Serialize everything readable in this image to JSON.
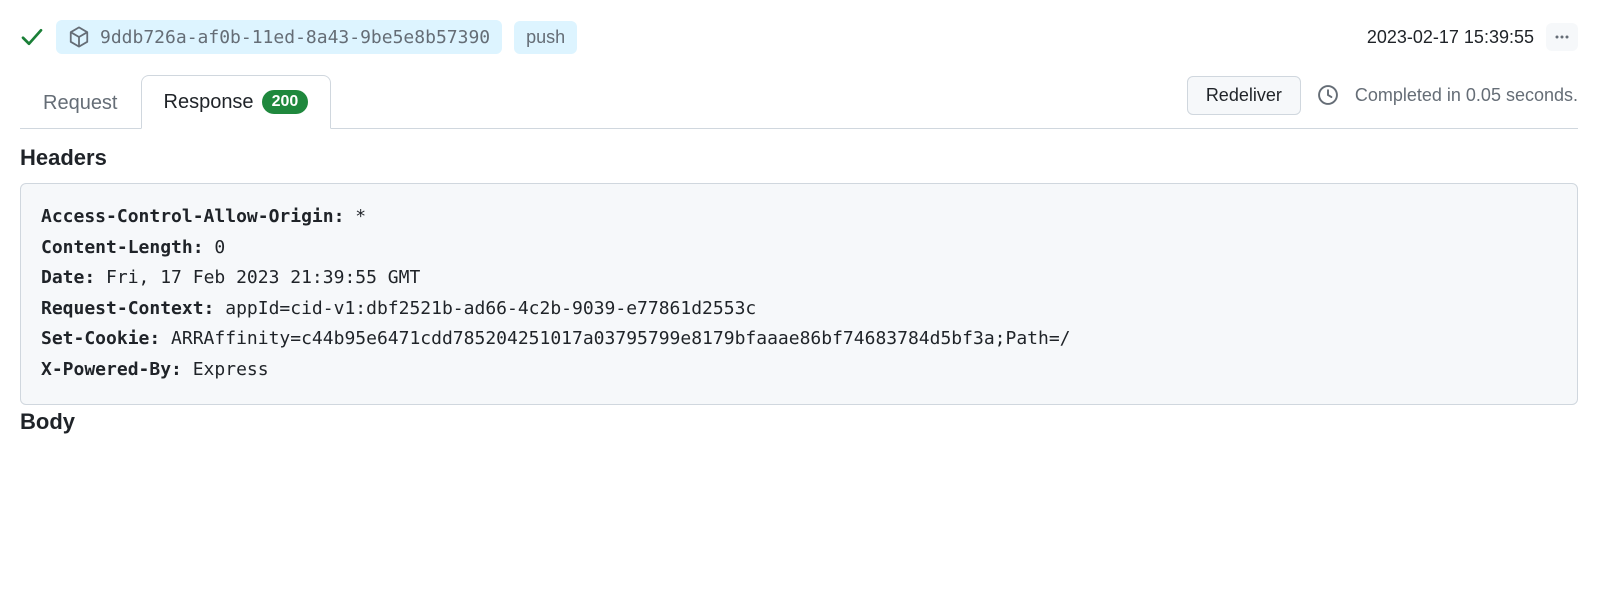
{
  "delivery": {
    "id": "9ddb726a-af0b-11ed-8a43-9be5e8b57390",
    "event": "push",
    "timestamp": "2023-02-17 15:39:55"
  },
  "tabs": {
    "request": "Request",
    "response": "Response",
    "status_code": "200"
  },
  "actions": {
    "redeliver": "Redeliver",
    "completed": "Completed in 0.05 seconds."
  },
  "sections": {
    "headers_title": "Headers",
    "body_title": "Body"
  },
  "headers": [
    {
      "key": "Access-Control-Allow-Origin:",
      "value": "*"
    },
    {
      "key": "Content-Length:",
      "value": "0"
    },
    {
      "key": "Date:",
      "value": "Fri, 17 Feb 2023 21:39:55 GMT"
    },
    {
      "key": "Request-Context:",
      "value": "appId=cid-v1:dbf2521b-ad66-4c2b-9039-e77861d2553c"
    },
    {
      "key": "Set-Cookie:",
      "value": "ARRAffinity=c44b95e6471cdd785204251017a03795799e8179bfaaae86bf74683784d5bf3a;Path=/"
    },
    {
      "key": "X-Powered-By:",
      "value": "Express"
    }
  ]
}
